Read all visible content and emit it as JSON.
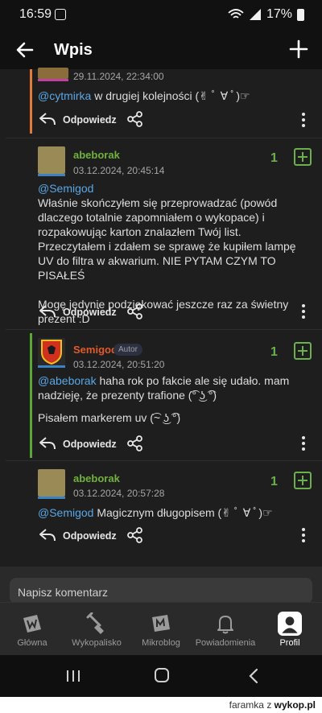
{
  "status_bar": {
    "time": "16:59",
    "battery": "17%"
  },
  "header": {
    "title": "Wpis"
  },
  "comments": [
    {
      "date": "29.11.2024, 22:34:00",
      "mention": "@cytmirka",
      "text": " w drugiej kolejności (✌ ﾟ ∀ ﾟ)☞",
      "reply": "Odpowiedz"
    },
    {
      "author": "abeborak",
      "date": "03.12.2024, 20:45:14",
      "votes": "1",
      "mention": "@Semigod",
      "text": "Właśnie skończyłem się przeprowadzać (powód dlaczego totalnie zapomniałem o wykopace) i rozpakowując karton znalazłem Twój list. Przeczytałem i zdałem se sprawę że kupiłem lampę UV do filtra w akwarium. NIE PYTAM CZYM TO PISAŁEŚ",
      "text2": "Mogę jedynie podziękować jeszcze raz za świetny prezent :D",
      "reply": "Odpowiedz"
    },
    {
      "author": "Semigod",
      "badge": "Autor",
      "date": "03.12.2024, 20:51:20",
      "votes": "1",
      "mention": "@abeborak",
      "text": " haha rok po fakcie ale się udało. mam nadzieję, że prezenty trafione (͡° ͜ʖ ͡°)",
      "text2": "Pisałem markerem uv (͡~ ͜ʖ ͡°)",
      "reply": "Odpowiedz"
    },
    {
      "author": "abeborak",
      "date": "03.12.2024, 20:57:28",
      "votes": "1",
      "mention": "@Semigod",
      "text": " Magicznym długopisem (✌ ﾟ ∀ ﾟ)☞",
      "reply": "Odpowiedz"
    }
  ],
  "compose": {
    "placeholder": "Napisz komentarz"
  },
  "tabs": [
    {
      "label": "Główna",
      "icon": "home-w-icon"
    },
    {
      "label": "Wykopalisko",
      "icon": "shovel-icon"
    },
    {
      "label": "Mikroblog",
      "icon": "mikroblog-icon"
    },
    {
      "label": "Powiadomienia",
      "icon": "bell-icon"
    },
    {
      "label": "Profil",
      "icon": "profile-icon",
      "active": true
    }
  ],
  "watermark": {
    "user": "faramka",
    "sep": "z",
    "site": "wykop.pl"
  },
  "colors": {
    "accent_green": "#6ab04c",
    "mention": "#5aa7e6",
    "author_op": "#e05a2c",
    "author": "#71b23c"
  }
}
